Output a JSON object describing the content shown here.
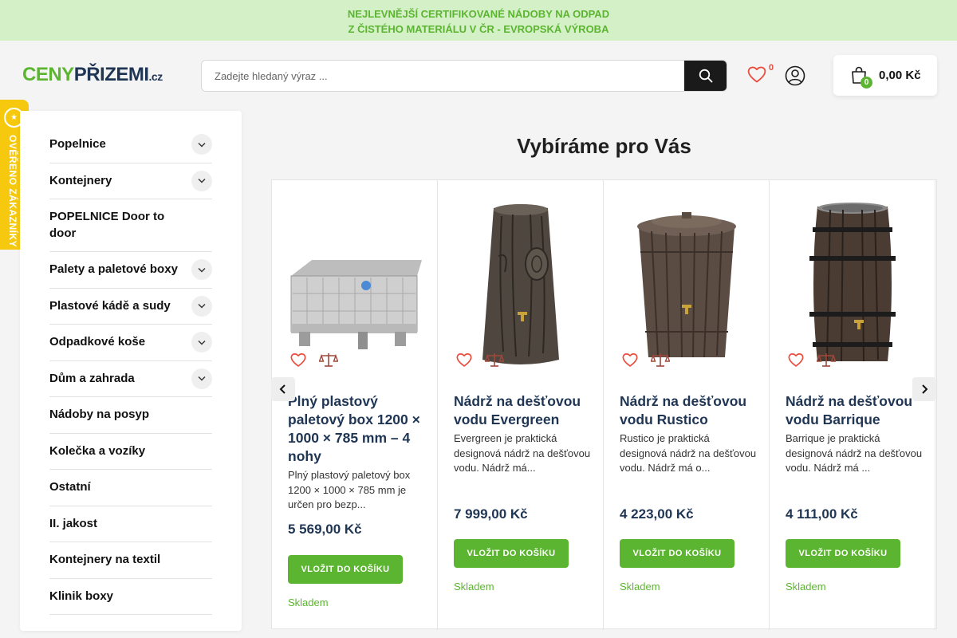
{
  "topbar": {
    "line1": "NEJLEVNĚJŠÍ CERTIFIKOVANÉ NÁDOBY NA ODPAD",
    "line2": "Z ČISTÉHO MATERIÁLU V ČR - EVROPSKÁ VÝROBA"
  },
  "logo": {
    "part1": "CENY",
    "part2": "PŘIZEMI",
    "part3": ".cz"
  },
  "search": {
    "placeholder": "Zadejte hledaný výraz ..."
  },
  "header": {
    "wishlist_count": "0",
    "cart_count": "0",
    "cart_total": "0,00 Kč"
  },
  "badge": {
    "text": "OVĚŘENO ZÁKAZNÍKY"
  },
  "sidebar": {
    "items": [
      {
        "label": "Popelnice",
        "has_children": true
      },
      {
        "label": "Kontejnery",
        "has_children": true
      },
      {
        "label": "POPELNICE Door to door",
        "has_children": false
      },
      {
        "label": "Palety a paletové boxy",
        "has_children": true
      },
      {
        "label": "Plastové kádě a sudy",
        "has_children": true
      },
      {
        "label": "Odpadkové koše",
        "has_children": true
      },
      {
        "label": "Dům a zahrada",
        "has_children": true
      },
      {
        "label": "Nádoby na posyp",
        "has_children": false
      },
      {
        "label": "Kolečka a vozíky",
        "has_children": false
      },
      {
        "label": "Ostatní",
        "has_children": false
      },
      {
        "label": "II. jakost",
        "has_children": false
      },
      {
        "label": "Kontejnery na textil",
        "has_children": false
      },
      {
        "label": "Klinik boxy",
        "has_children": false
      }
    ]
  },
  "main": {
    "title": "Vybíráme pro Vás",
    "products": [
      {
        "title": "Plný plastový paletový box 1200 × 1000 × 785 mm – 4 nohy",
        "description": "Plný plastový paletový box 1200 × 1000 × 785 mm je určen pro bezp...",
        "price": "5 569,00 Kč",
        "button": "VLOŽIT DO KOŠÍKU",
        "stock": "Skladem",
        "image": "pallet-box"
      },
      {
        "title": "Nádrž na dešťovou vodu Evergreen",
        "description": "Evergreen je praktická designová nádrž na dešťovou vodu. Nádrž má...",
        "price": "7 999,00 Kč",
        "button": "VLOŽIT DO KOŠÍKU",
        "stock": "Skladem",
        "image": "tree-trunk-tank"
      },
      {
        "title": "Nádrž na dešťovou vodu Rustico",
        "description": "Rustico je praktická designová nádrž na dešťovou vodu. Nádrž má o...",
        "price": "4 223,00 Kč",
        "button": "VLOŽIT DO KOŠÍKU",
        "stock": "Skladem",
        "image": "rustico-tank"
      },
      {
        "title": "Nádrž na dešťovou vodu Barrique",
        "description": "Barrique je praktická designová nádrž na dešťovou vodu. Nádrž má ...",
        "price": "4 111,00 Kč",
        "button": "VLOŽIT DO KOŠÍKU",
        "stock": "Skladem",
        "image": "barrel-tank"
      }
    ]
  },
  "colors": {
    "green": "#5cb531",
    "navy": "#1f3554",
    "yellow": "#f6c90e",
    "heart": "#e94b3c",
    "compare": "#a0483a"
  }
}
